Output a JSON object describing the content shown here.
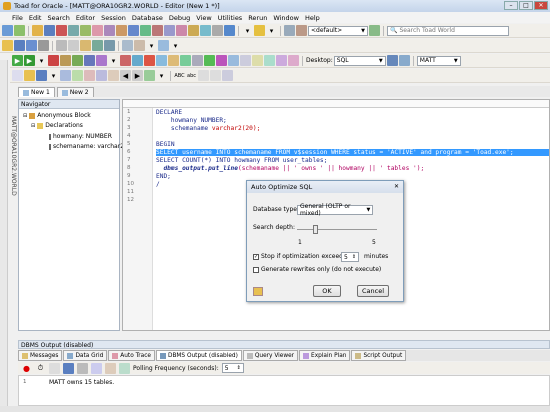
{
  "window": {
    "title": "Toad for Oracle - [MATT@ORA10GR2.WORLD - Editor (New 1 *)]"
  },
  "menu": [
    "File",
    "Edit",
    "Search",
    "Editor",
    "Session",
    "Database",
    "Debug",
    "View",
    "Utilities",
    "Rerun",
    "Window",
    "Help"
  ],
  "toolbar": {
    "default_combo": "<default>",
    "search_placeholder": "Search Toad World",
    "desktop_label": "Desktop:",
    "desktop_value": "SQL",
    "schema_value": "MATT"
  },
  "doc_tabs": [
    {
      "label": "New 1"
    },
    {
      "label": "New 2"
    }
  ],
  "navigator": {
    "title": "Navigator",
    "vertical_label": "MATT@ORA10GR2.WORLD",
    "root": "Anonymous Block",
    "declarations": "Declarations",
    "items": [
      "howmany: NUMBER",
      "schemaname: varchar2"
    ]
  },
  "editor": {
    "lines": [
      "1",
      "2",
      "3",
      "4",
      "5",
      "6",
      "7",
      "8",
      "9",
      "10",
      "11",
      "12"
    ],
    "code": {
      "l1": "DECLARE",
      "l2": "    howmany NUMBER;",
      "l3a": "    schemaname ",
      "l3b": "varchar2(20);",
      "l5": "BEGIN",
      "l6": "SELECT username INTO schemaname FROM v$session WHERE status = 'ACTIVE' and program = 'Toad.exe';",
      "l7": "SELECT COUNT(*) INTO howmany FROM user_tables;",
      "l8a": "  dbms_output.put_line",
      "l8b": "(schemaname || ' owns ' || howmany || ' tables ');",
      "l9": "END;",
      "l10": "/"
    }
  },
  "dialog": {
    "title": "Auto Optimize SQL",
    "db_type_label": "Database type:",
    "db_type_value": "General (OLTP or mixed)",
    "search_depth_label": "Search depth:",
    "depth_min": "1",
    "depth_max": "5",
    "stop_label": "Stop if optimization exceeds:",
    "stop_value": "5",
    "stop_unit": "minutes",
    "generate_label": "Generate rewrites only (do not execute)",
    "ok": "OK",
    "cancel": "Cancel",
    "stop_checked": true,
    "generate_checked": false
  },
  "bottom": {
    "title": "DBMS Output (disabled)",
    "tabs": [
      "Messages",
      "Data Grid",
      "Auto Trace",
      "DBMS Output (disabled)",
      "Query Viewer",
      "Explain Plan",
      "Script Output"
    ],
    "polling_label": "Polling Frequency (seconds):",
    "polling_value": "5",
    "output_line_no": "1",
    "output_text": "MATT owns 15 tables."
  },
  "colors": {
    "selection": "#3399ff",
    "keyword": "#1a2a8a",
    "string": "#b00060"
  }
}
